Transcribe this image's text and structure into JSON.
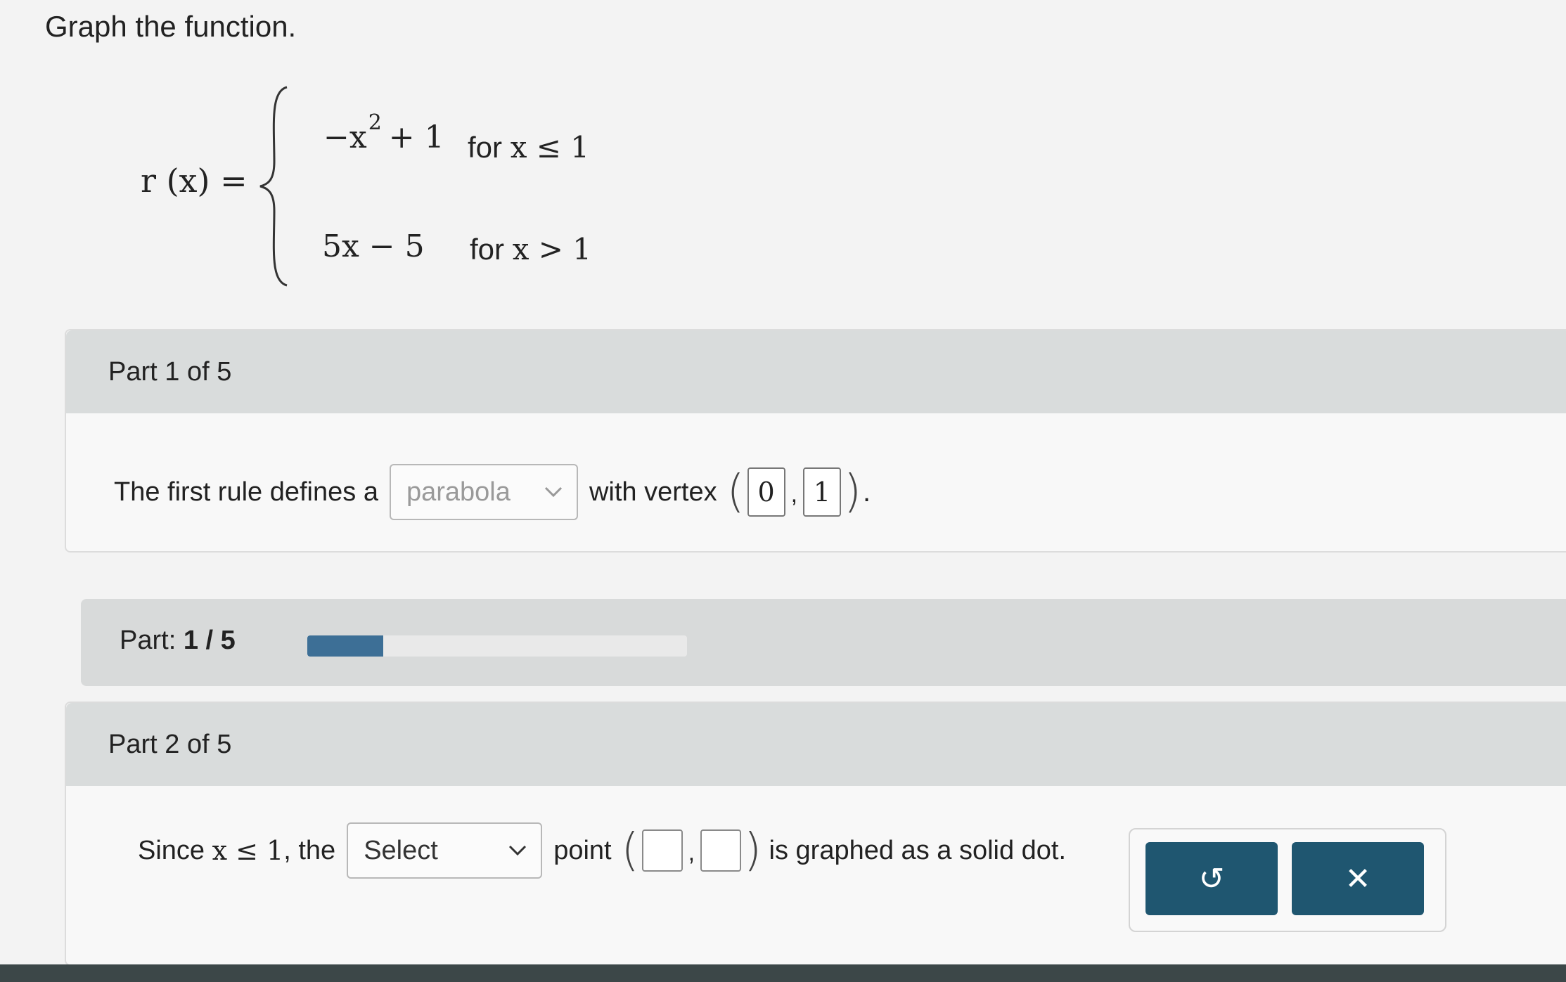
{
  "prompt": "Graph the function.",
  "function": {
    "lhs": "r (x) =",
    "case1": {
      "expr_prefix": "−x",
      "exponent": "2",
      "expr_suffix": "+ 1",
      "cond_word": "for",
      "cond_math": "x ≤ 1"
    },
    "case2": {
      "expr": "5x − 5",
      "cond_word": "for",
      "cond_math": "x > 1"
    }
  },
  "part1": {
    "header": "Part 1 of 5",
    "text_before": "The first rule defines a",
    "select_value": "parabola",
    "text_middle": "with vertex",
    "vertex_x": "0",
    "vertex_y": "1",
    "comma": ",",
    "period": "."
  },
  "progress": {
    "label": "Part:",
    "value_text": "1 / 5",
    "fraction": 0.2
  },
  "part2": {
    "header": "Part 2 of 5",
    "text_since": "Since",
    "math_condition": "x ≤ 1",
    "text_the": ", the",
    "select_value": "Select",
    "text_point": "point",
    "point_x": "",
    "point_y": "",
    "comma": ",",
    "text_after": "is graphed as a solid dot."
  },
  "actions": {
    "undo_icon": "undo-icon",
    "clear_icon": "close-icon",
    "undo_glyph": "↺",
    "clear_glyph": "✕",
    "button_color": "#1f5670"
  },
  "colors": {
    "progress_fill": "#3d6f96",
    "header_bg": "#d9dcdc"
  }
}
